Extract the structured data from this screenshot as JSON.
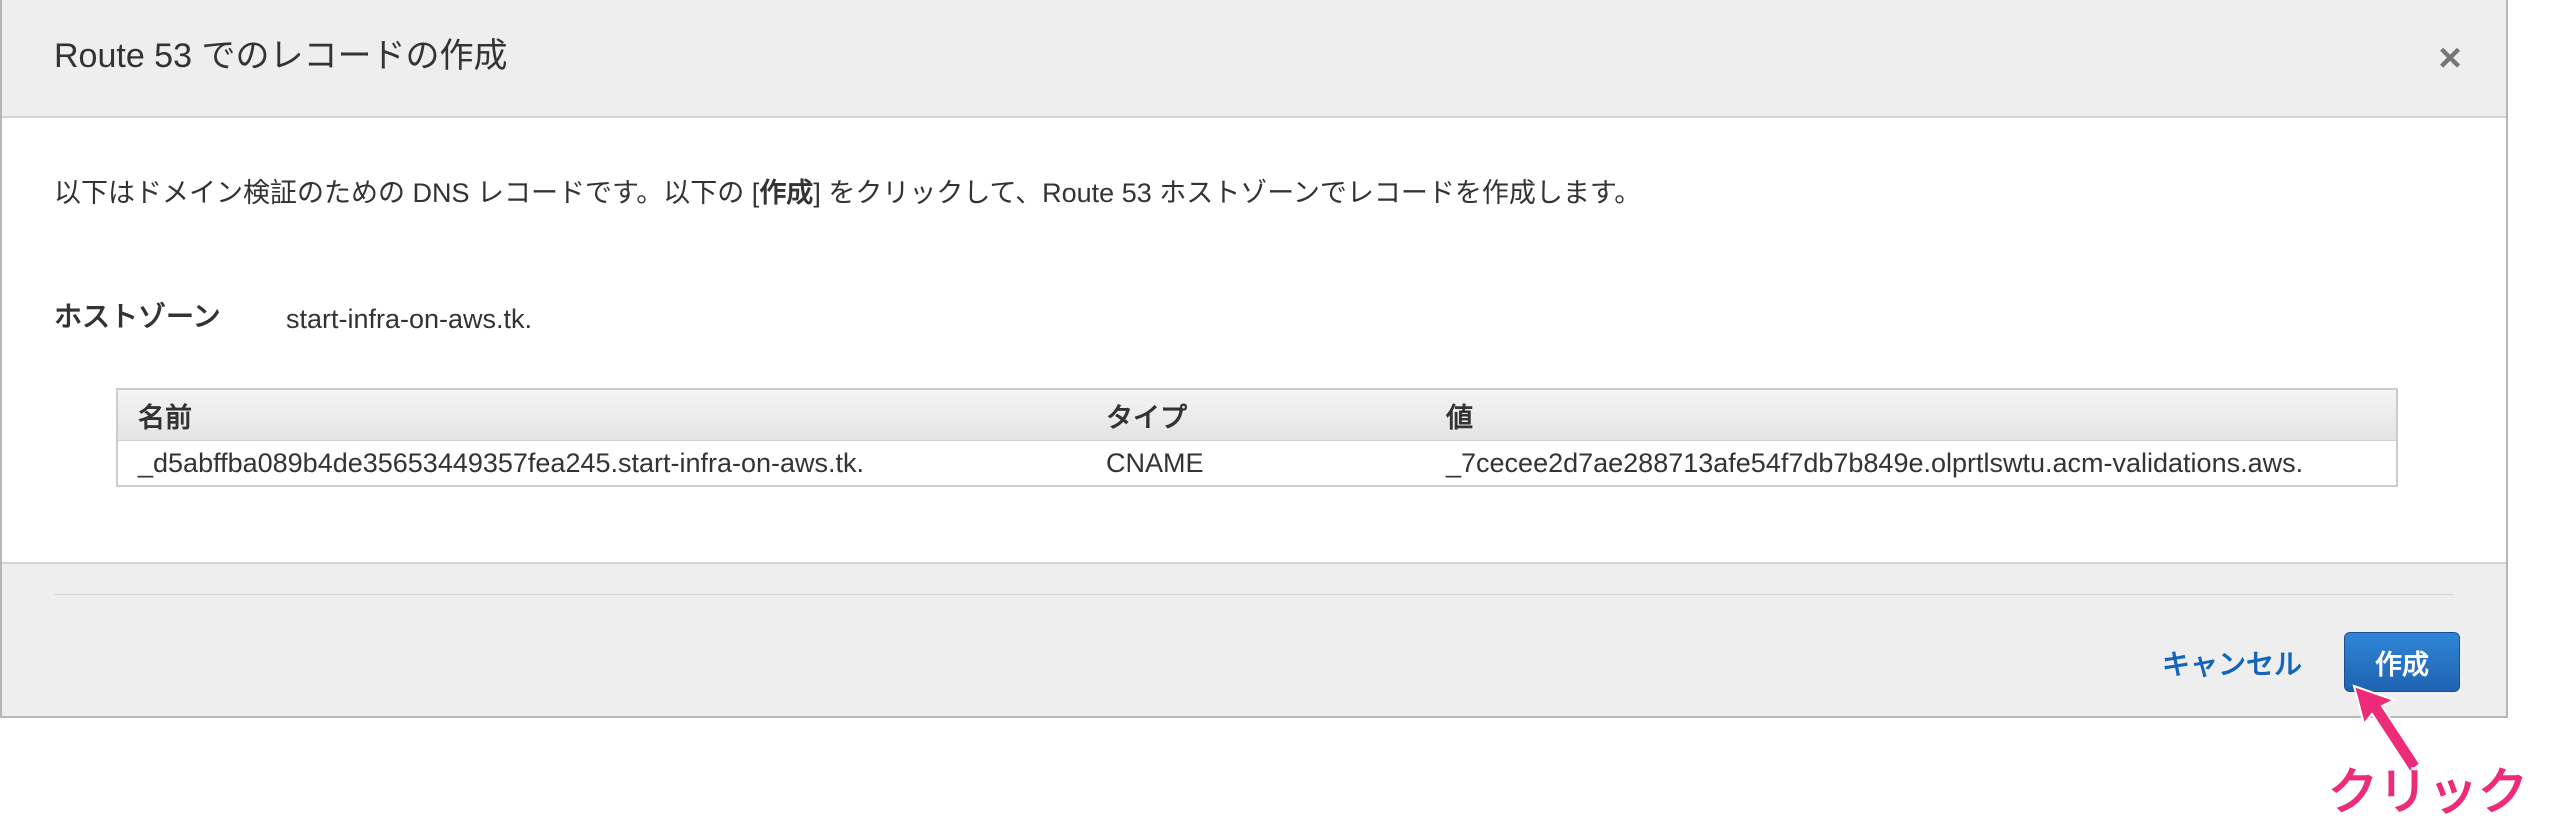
{
  "dialog": {
    "title": "Route 53 でのレコードの作成",
    "close_symbol": "×"
  },
  "description": {
    "before": "以下はドメイン検証のための DNS レコードです。以下の [",
    "bold": "作成",
    "after": "] をクリックして、Route 53 ホストゾーンでレコードを作成します。"
  },
  "hosted_zone": {
    "label": "ホストゾーン",
    "value": "start-infra-on-aws.tk."
  },
  "records_table": {
    "headers": [
      "名前",
      "タイプ",
      "値"
    ],
    "rows": [
      [
        "_d5abffba089b4de35653449357fea245.start-infra-on-aws.tk.",
        "CNAME",
        "_7cecee2d7ae288713afe54f7db7b849e.olprtlswtu.acm-validations.aws."
      ]
    ]
  },
  "footer": {
    "cancel_label": "キャンセル",
    "create_label": "作成"
  },
  "annotation": {
    "text": "クリック",
    "color": "#ee2b78"
  },
  "colors": {
    "primary_button": "#1f6fc5",
    "link": "#1166bb",
    "header_bg": "#eeeeee"
  }
}
